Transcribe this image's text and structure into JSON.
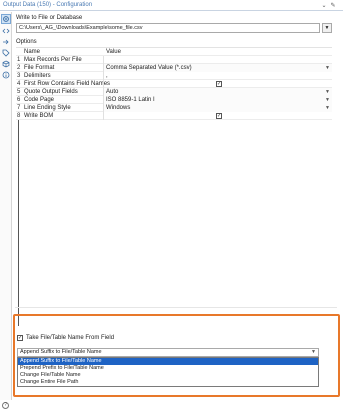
{
  "window": {
    "title": "Output Data (150) - Configuration"
  },
  "toolbar": {
    "icons": [
      "gear-icon",
      "code-icon",
      "arrow-icon",
      "tag-icon",
      "cube-icon",
      "info-icon"
    ]
  },
  "file": {
    "label": "Write to File or Database",
    "value": "C:\\Users\\_AG_\\Downloads\\Example\\some_file.csv"
  },
  "options": {
    "label": "Options",
    "col_name": "Name",
    "col_value": "Value",
    "rows": [
      {
        "num": "1",
        "name": "Max Records Per File",
        "value": "",
        "kind": "text"
      },
      {
        "num": "2",
        "name": "File Format",
        "value": "Comma Separated Value (*.csv)",
        "kind": "dropdown"
      },
      {
        "num": "3",
        "name": "Delimiters",
        "value": ",",
        "kind": "text"
      },
      {
        "num": "4",
        "name": "First Row Contains Field Names",
        "value": "",
        "kind": "checkbox"
      },
      {
        "num": "5",
        "name": "Quote Output Fields",
        "value": "Auto",
        "kind": "dropdown"
      },
      {
        "num": "6",
        "name": "Code Page",
        "value": "ISO 8859-1 Latin I",
        "kind": "dropdown"
      },
      {
        "num": "7",
        "name": "Line Ending Style",
        "value": "Windows",
        "kind": "dropdown"
      },
      {
        "num": "8",
        "name": "Write BOM",
        "value": "",
        "kind": "checkbox"
      }
    ]
  },
  "take_field": {
    "label": "Take File/Table Name From Field",
    "checked": true,
    "selected": "Append Suffix to File/Table Name",
    "options": [
      "Append Suffix to File/Table Name",
      "Prepend Prefix to File/Table Name",
      "Change File/Table Name",
      "Change Entire File Path"
    ]
  },
  "colors": {
    "highlight": "#e8782a",
    "selection": "#1e63c4",
    "title": "#4a7ab3"
  }
}
